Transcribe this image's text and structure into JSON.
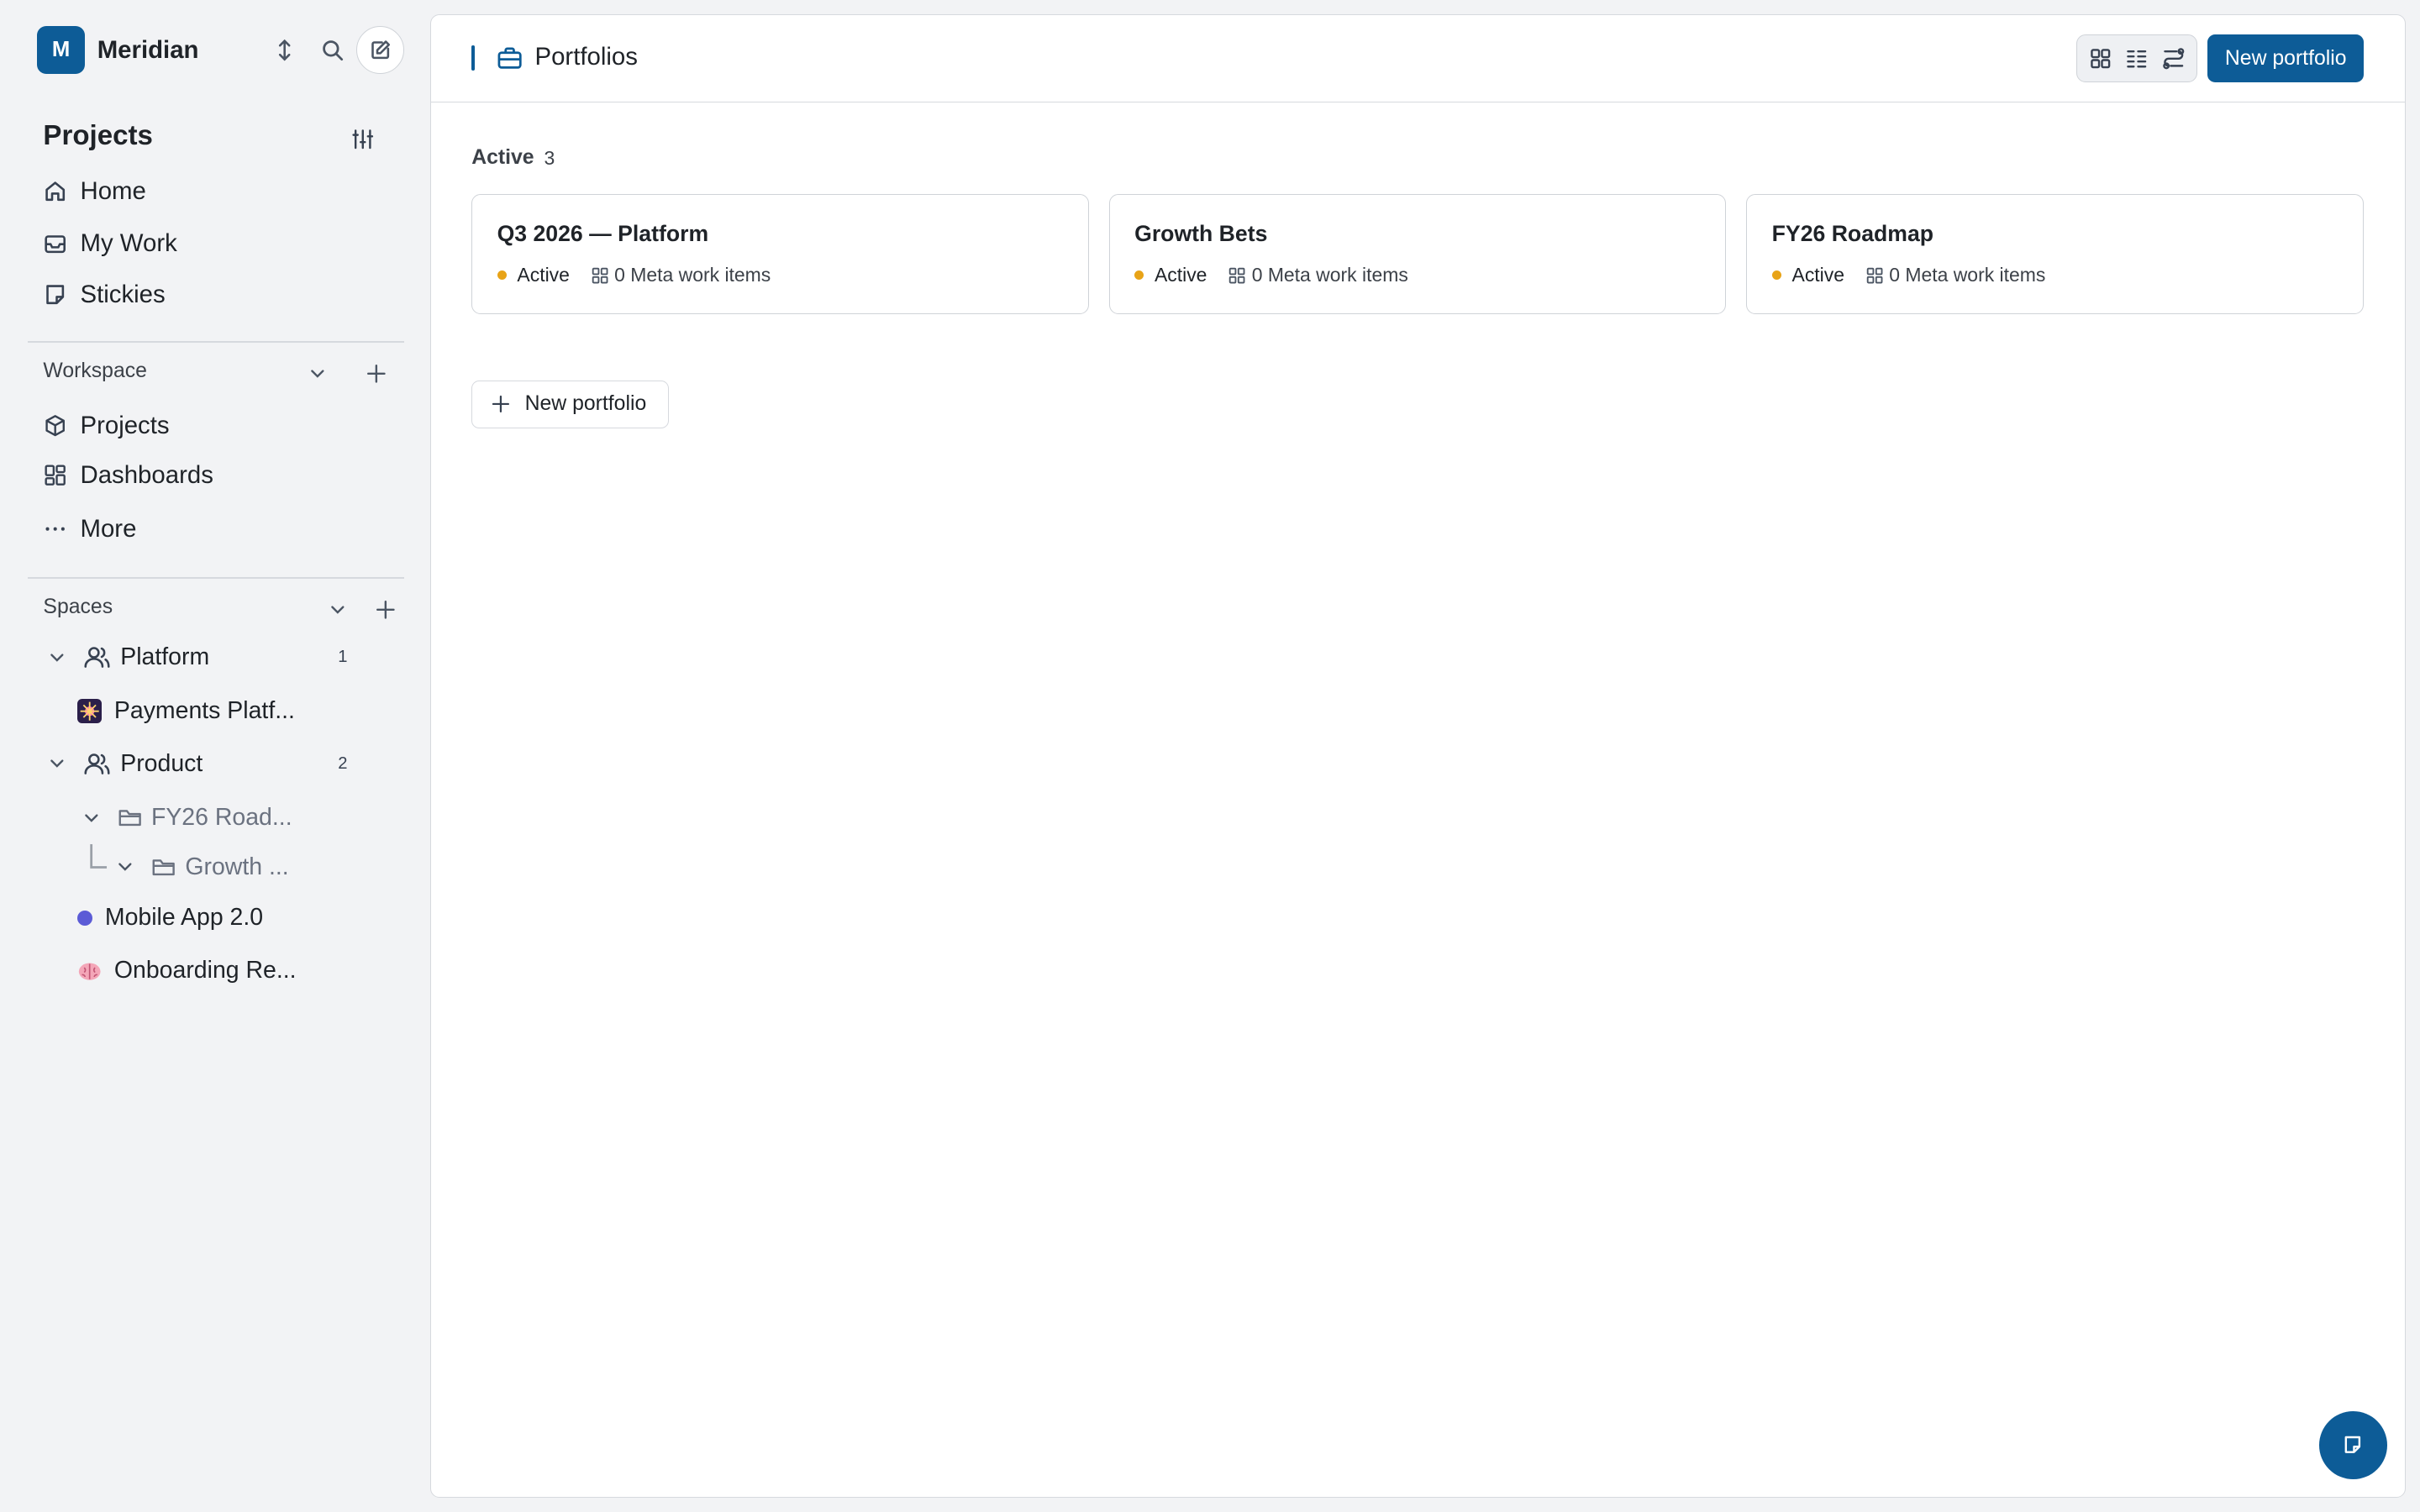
{
  "workspace": {
    "initial": "M",
    "name": "Meridian"
  },
  "sidebar": {
    "projects_title": "Projects",
    "nav": [
      {
        "label": "Home",
        "icon": "home-icon"
      },
      {
        "label": "My Work",
        "icon": "inbox-icon"
      },
      {
        "label": "Stickies",
        "icon": "sticky-note-icon"
      }
    ],
    "workspace_section": {
      "title": "Workspace",
      "items": [
        {
          "label": "Projects",
          "icon": "box-icon"
        },
        {
          "label": "Dashboards",
          "icon": "dashboard-icon"
        },
        {
          "label": "More",
          "icon": "ellipsis-icon"
        }
      ]
    },
    "spaces_section": {
      "title": "Spaces",
      "spaces": [
        {
          "label": "Platform",
          "count": "1",
          "children": [
            {
              "label": "Payments Platf..."
            }
          ]
        },
        {
          "label": "Product",
          "count": "2",
          "children": [
            {
              "label": "FY26 Road...",
              "children": [
                {
                  "label": "Growth ..."
                }
              ]
            }
          ]
        }
      ],
      "projects": [
        {
          "label": "Mobile App 2.0",
          "color": "#5b5bd6"
        },
        {
          "label": "Onboarding Re..."
        }
      ]
    }
  },
  "header": {
    "title": "Portfolios",
    "new_button": "New portfolio"
  },
  "group": {
    "label": "Active",
    "count": "3"
  },
  "cards": [
    {
      "title": "Q3 2026 — Platform",
      "status": "Active",
      "meta": "0 Meta work items"
    },
    {
      "title": "Growth Bets",
      "status": "Active",
      "meta": "0 Meta work items"
    },
    {
      "title": "FY26 Roadmap",
      "status": "Active",
      "meta": "0 Meta work items"
    }
  ],
  "add_button": "New portfolio",
  "colors": {
    "accent": "#0d5c97",
    "status_active": "#e8a317"
  }
}
